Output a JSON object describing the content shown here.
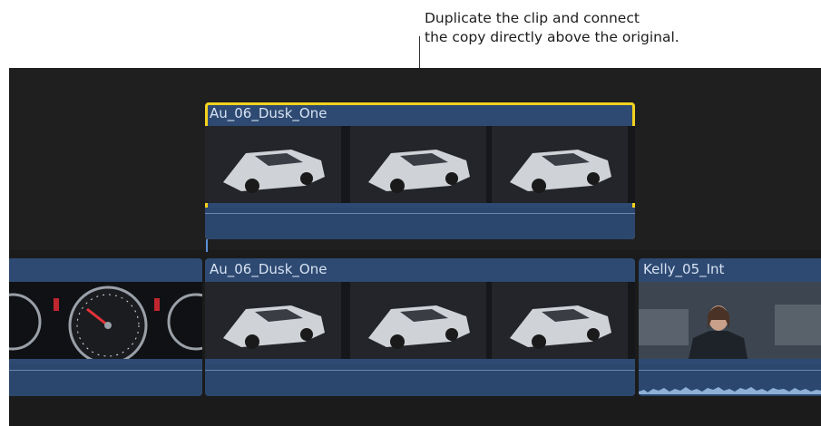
{
  "callout": {
    "line1": "Duplicate the clip and connect",
    "line2": "the copy directly above the original."
  },
  "timeline": {
    "connected_clip": {
      "name": "Au_06_Dusk_One",
      "selected": true
    },
    "primary_clips": [
      {
        "name": "",
        "content": "speedometer"
      },
      {
        "name": "Au_06_Dusk_One",
        "content": "car"
      },
      {
        "name": "Kelly_05_Int",
        "content": "interview"
      }
    ]
  },
  "colors": {
    "selection": "#f4d21d",
    "clip": "#2e4a72",
    "background": "#1f1f20"
  }
}
